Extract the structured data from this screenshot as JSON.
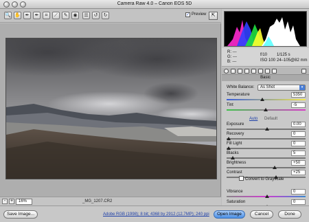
{
  "window": {
    "title": "Camera Raw 4.0  –  Canon EOS 5D"
  },
  "toolbar": {
    "tools": [
      {
        "name": "zoom-tool-icon",
        "glyph": "🔍"
      },
      {
        "name": "hand-tool-icon",
        "glyph": "✋"
      },
      {
        "name": "white-balance-tool-icon",
        "glyph": "✒"
      },
      {
        "name": "color-sampler-tool-icon",
        "glyph": "✒"
      },
      {
        "name": "crop-tool-icon",
        "glyph": "⌗"
      },
      {
        "name": "straighten-tool-icon",
        "glyph": "⟋"
      },
      {
        "name": "retouch-tool-icon",
        "glyph": "✎"
      },
      {
        "name": "red-eye-tool-icon",
        "glyph": "◉"
      },
      {
        "name": "preferences-icon",
        "glyph": "☰"
      },
      {
        "name": "rotate-left-icon",
        "glyph": "↺"
      },
      {
        "name": "rotate-right-icon",
        "glyph": "↻"
      }
    ],
    "preview_label": "Preview",
    "preview_checked": "✓",
    "fullscreen_glyph": "⇱"
  },
  "histogram": {
    "colors": {
      "red": "#ff2020",
      "green": "#20ff20",
      "blue": "#3040ff",
      "white": "#ffffff",
      "magenta": "#ff40ff",
      "yellow": "#ffff30",
      "cyan": "#30ffff"
    }
  },
  "info": {
    "r": "R:   ---",
    "g": "G:   ---",
    "b": "B:   ---",
    "aperture": "f/10",
    "shutter": "1/125 s",
    "iso": "ISO 100",
    "lens": "24–105@82 mm"
  },
  "panel": {
    "title": "Basic",
    "white_balance_label": "White Balance:",
    "white_balance_value": "As Shot",
    "auto_label": "Auto",
    "default_label": "Default",
    "convert_grayscale_label": "Convert to Grayscale",
    "sliders": [
      {
        "label": "Temperature",
        "value": "5350",
        "level": 0.44
      },
      {
        "label": "Tint",
        "value": "-5",
        "level": 0.48
      },
      {
        "label": "Exposure",
        "value": "0.00",
        "level": 0.5
      },
      {
        "label": "Recovery",
        "value": "0",
        "level": 0.0
      },
      {
        "label": "Fill Light",
        "value": "0",
        "level": 0.0
      },
      {
        "label": "Blacks",
        "value": "5",
        "level": 0.05
      },
      {
        "label": "Brightness",
        "value": "+50",
        "level": 0.6
      },
      {
        "label": "Contrast",
        "value": "+25",
        "level": 0.62
      },
      {
        "label": "Vibrance",
        "value": "0",
        "level": 0.5
      },
      {
        "label": "Saturation",
        "value": "0",
        "level": 0.5
      }
    ]
  },
  "statusbar": {
    "zoom_minus": "-",
    "zoom_plus": "+",
    "zoom_value": "16%",
    "filename": "_MG_1207.CR2"
  },
  "bottom": {
    "save_label": "Save Image...",
    "workflow_link": "Adobe RGB (1998); 8 bit; 4368 by 2912 (12.7MP); 240 ppi",
    "open_label": "Open Image",
    "cancel_label": "Cancel",
    "done_label": "Done"
  }
}
